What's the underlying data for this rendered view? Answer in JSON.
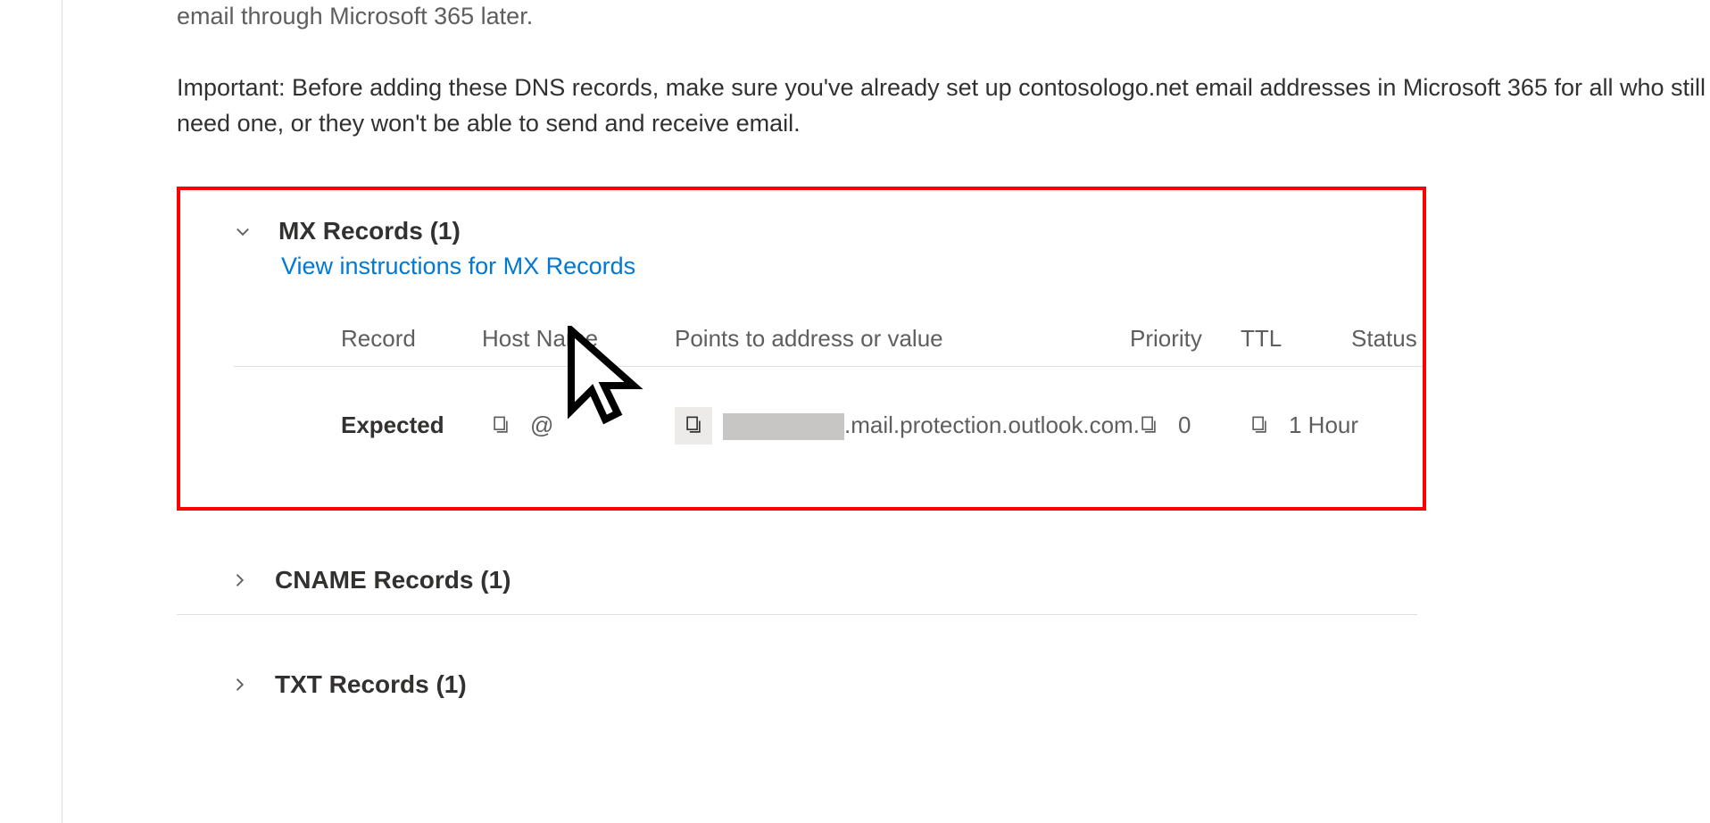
{
  "intro_partial": "email through Microsoft 365 later.",
  "important_note": "Important: Before adding these DNS records, make sure you've already set up contosologo.net email addresses in Microsoft 365 for all who still need one, or they won't be able to send and receive email.",
  "sections": {
    "mx": {
      "title": "MX Records (1)",
      "instructions_link": "View instructions for MX Records",
      "columns": {
        "record": "Record",
        "hostname": "Host Name",
        "points": "Points to address or value",
        "priority": "Priority",
        "ttl": "TTL",
        "status": "Status"
      },
      "row": {
        "record": "Expected",
        "hostname": "@",
        "points_suffix": ".mail.protection.outlook.com.",
        "priority": "0",
        "ttl": "1 Hour"
      }
    },
    "cname": {
      "title": "CNAME Records (1)"
    },
    "txt": {
      "title": "TXT Records (1)"
    }
  }
}
